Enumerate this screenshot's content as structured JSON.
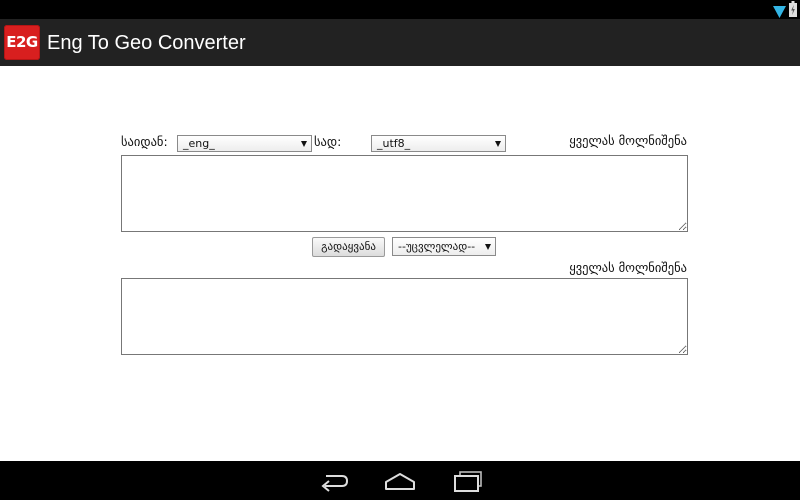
{
  "app": {
    "logo_text": "E2G",
    "title": "Eng To Geo Converter",
    "brand_color": "#d81f1f"
  },
  "status_bar": {
    "icons": [
      "wifi-icon",
      "battery-icon"
    ]
  },
  "converter": {
    "from_label": "საიდან:",
    "from_selected": "_eng_",
    "to_label": "სად:",
    "to_selected": "_utf8_",
    "select_all_top": "ყველას მოლნიშენა",
    "input_value": "",
    "convert_button": "გადაყვანა",
    "mode_selected": "--უცვლელად--",
    "select_all_bottom": "ყველას მოლნიშენა",
    "output_value": ""
  },
  "nav_bar": {
    "icons": [
      "back-icon",
      "home-icon",
      "recent-apps-icon"
    ]
  }
}
